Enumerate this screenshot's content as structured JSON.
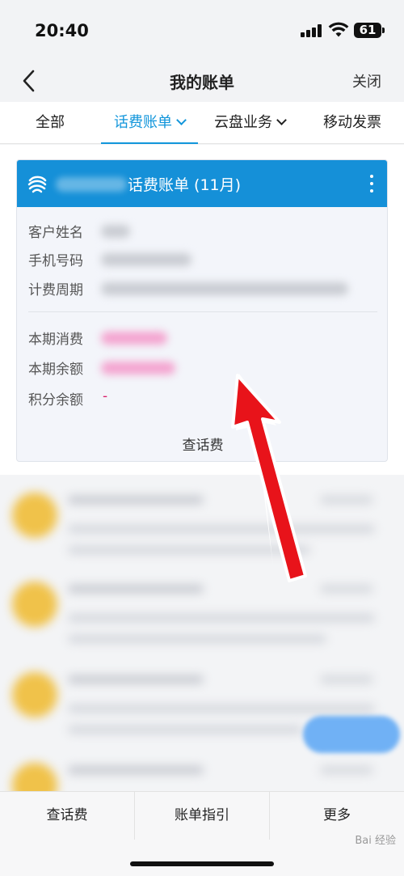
{
  "status_bar": {
    "time": "20:40",
    "battery": "61"
  },
  "nav": {
    "title": "我的账单",
    "close_label": "关闭"
  },
  "tabs": [
    {
      "label": "全部",
      "active": false
    },
    {
      "label": "话费账单",
      "active": true
    },
    {
      "label": "云盘业务",
      "active": false
    },
    {
      "label": "移动发票",
      "active": false
    }
  ],
  "bill_card": {
    "title": "话费账单 (11月)",
    "rows": [
      {
        "label": "客户姓名"
      },
      {
        "label": "手机号码"
      },
      {
        "label": "计费周期"
      },
      {
        "label": "本期消费"
      },
      {
        "label": "本期余额"
      },
      {
        "label": "积分余额",
        "value": "-"
      }
    ],
    "action_label": "查话费"
  },
  "toolbar": {
    "items": [
      "查话费",
      "账单指引",
      "更多"
    ]
  },
  "watermark": "Bai 经验",
  "colors": {
    "accent": "#1296db",
    "card_header": "#1590d8",
    "arrow": "#e8131a",
    "highlight": "#d81e6a"
  }
}
